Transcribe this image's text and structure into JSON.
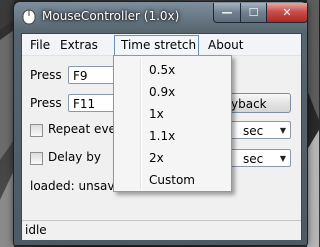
{
  "window": {
    "title": "MouseController (1.0x)",
    "min_glyph": "—",
    "max_glyph": "☐",
    "close_glyph": "✕"
  },
  "menu": {
    "file": "File",
    "extras": "Extras",
    "time_stretch": "Time stretch",
    "about": "About"
  },
  "controls": {
    "press_label_1": "Press",
    "press_key_1": "F9",
    "press_label_2": "Press",
    "press_key_2": "F11",
    "button_text": "yback",
    "repeat_label": "Repeat ever",
    "repeat_unit": "sec",
    "delay_label": "Delay by",
    "delay_unit": "sec",
    "loaded_text": "loaded:  unsave"
  },
  "dropdown": {
    "items": [
      "0.5x",
      "0.9x",
      "1x",
      "1.1x",
      "2x",
      "Custom"
    ]
  },
  "status": {
    "text": "idle"
  },
  "icons": {
    "app": "mouse-icon",
    "minimize": "minimize-icon",
    "maximize": "maximize-icon",
    "close": "close-icon",
    "dropdown_arrow": "chevron-down-icon"
  },
  "colors": {
    "titlebar": "#6c7b89",
    "close_button": "#c75050",
    "menu_highlight": "#6e8fb5"
  }
}
